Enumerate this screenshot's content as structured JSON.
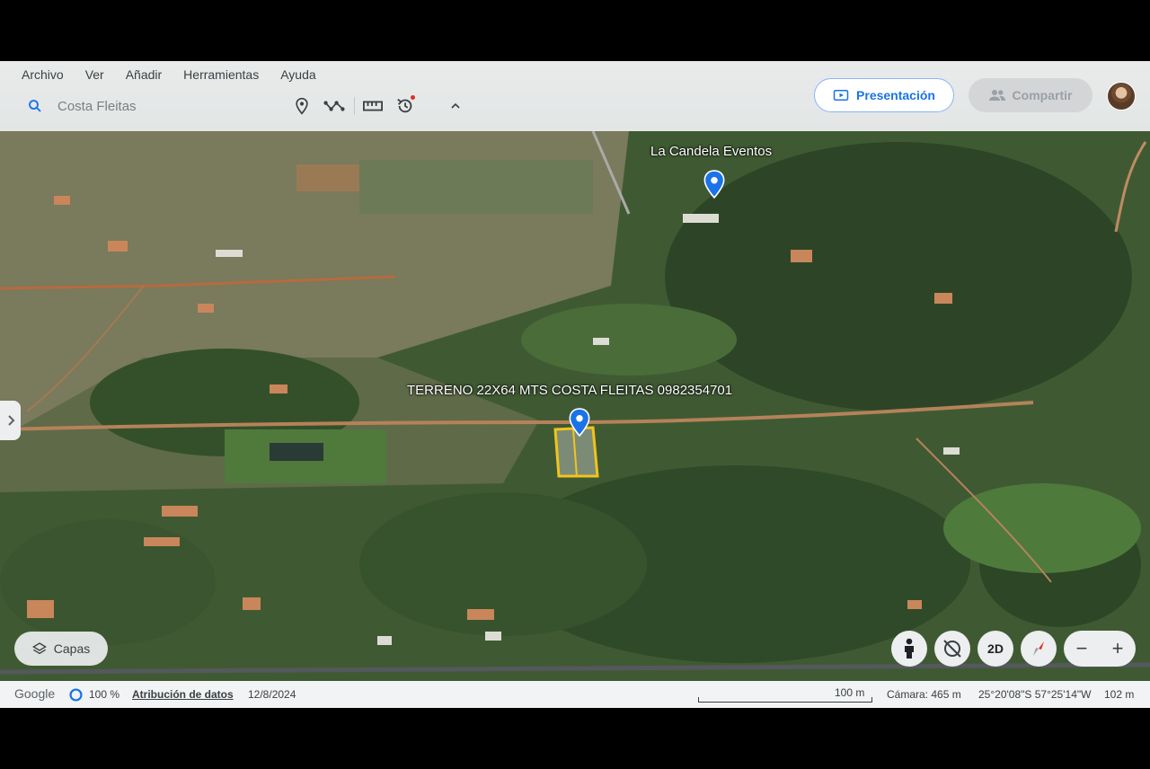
{
  "menu": [
    "Archivo",
    "Ver",
    "Añadir",
    "Herramientas",
    "Ayuda"
  ],
  "search": {
    "placeholder": "Costa Fleitas"
  },
  "toolbar_icons": [
    "placemark-icon",
    "path-icon",
    "ruler-icon",
    "history-icon",
    "chevron-up-icon"
  ],
  "buttons": {
    "present": "Presentación",
    "share": "Compartir"
  },
  "places": {
    "top": "La Candela Eventos",
    "main": "TERRENO 22X64 MTS COSTA FLEITAS 0982354701"
  },
  "controls": {
    "layers": "Capas",
    "view_mode": "2D",
    "zoom_out": "−",
    "zoom_in": "+"
  },
  "status": {
    "logo": "Google",
    "load_percent": "100 %",
    "attribution": "Atribución de datos",
    "date": "12/8/2024",
    "scale": "100 m",
    "camera": "Cámara: 465 m",
    "coords": "25°20'08\"S 57°25'14\"W",
    "elevation": "102 m"
  },
  "colors": {
    "accent": "#1a73e8",
    "pin": "#1a73e8",
    "plot_outline": "#f2c31b"
  }
}
